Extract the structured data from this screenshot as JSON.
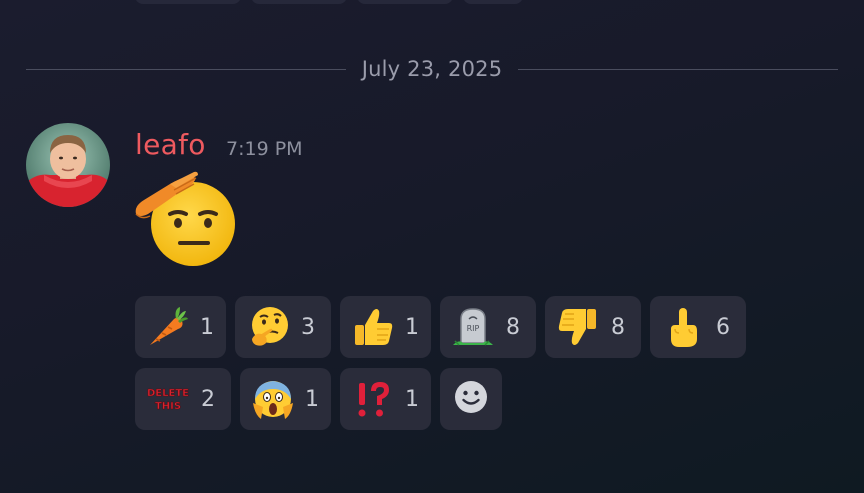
{
  "divider": {
    "date": "July 23, 2025"
  },
  "message": {
    "author": "leafo",
    "author_color": "#ee5a5f",
    "timestamp": "7:19 PM",
    "content_emoji": "saluting-face-icon"
  },
  "reactions": [
    {
      "emoji": "carrot-icon",
      "count": "1"
    },
    {
      "emoji": "thinking-face-icon",
      "count": "3"
    },
    {
      "emoji": "thumbs-up-icon",
      "count": "1"
    },
    {
      "emoji": "rip-tombstone-icon",
      "count": "8"
    },
    {
      "emoji": "thumbs-down-icon",
      "count": "8"
    },
    {
      "emoji": "middle-finger-icon",
      "count": "6"
    },
    {
      "emoji": "delete-this-icon",
      "count": "2",
      "emoji_text": "DELETE THIS"
    },
    {
      "emoji": "screaming-face-icon",
      "count": "1"
    },
    {
      "emoji": "interrobang-icon",
      "count": "1"
    }
  ],
  "add_reaction": {
    "icon": "smiley-add-reaction-icon"
  },
  "colors": {
    "background": "#1b1c2e",
    "reaction_bg": "#2a2c3a",
    "count_text": "#c9ccd4",
    "divider_text": "#9a9cab"
  }
}
